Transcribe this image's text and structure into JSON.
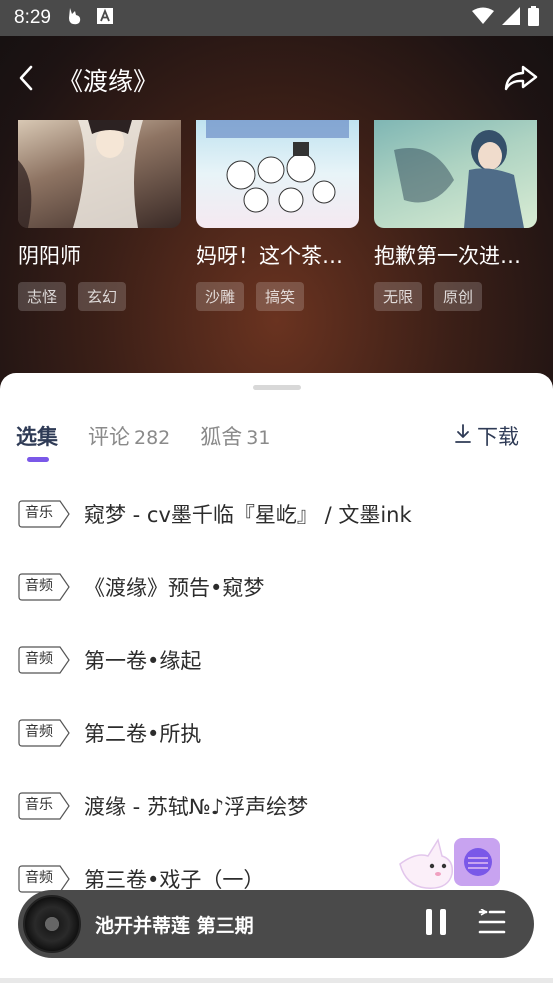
{
  "status_bar": {
    "time": "8:29",
    "icons_left": [
      "notification-bunny-icon",
      "text-a-icon"
    ],
    "icons_right": [
      "wifi-icon",
      "signal-icon",
      "battery-icon"
    ]
  },
  "header": {
    "title": "《渡缘》"
  },
  "recommendations": [
    {
      "title": "阴阳师",
      "tags": [
        "志怪",
        "玄幻"
      ]
    },
    {
      "title": "妈呀！这个茶…",
      "tags": [
        "沙雕",
        "搞笑"
      ]
    },
    {
      "title": "抱歉第一次进…",
      "tags": [
        "无限",
        "原创"
      ]
    }
  ],
  "tabs": [
    {
      "label": "选集",
      "count": ""
    },
    {
      "label": "评论",
      "count": "282"
    },
    {
      "label": "狐舍",
      "count": "31"
    }
  ],
  "download_label": "下载",
  "episodes": [
    {
      "badge": "音乐",
      "title": "窥梦 - cv墨千临『星屹』 / 文墨ink"
    },
    {
      "badge": "音频",
      "title": "《渡缘》预告•窥梦"
    },
    {
      "badge": "音频",
      "title": "第一卷•缘起"
    },
    {
      "badge": "音频",
      "title": "第二卷•所执"
    },
    {
      "badge": "音乐",
      "title": "渡缘 - 苏轼№♪浮声绘梦"
    },
    {
      "badge": "音频",
      "title": "第三卷•戏子（一）"
    }
  ],
  "player": {
    "title": "池开并蒂莲 第三期"
  },
  "colors": {
    "accent": "#7a58e8",
    "player_bg": "#4a4a4a"
  }
}
